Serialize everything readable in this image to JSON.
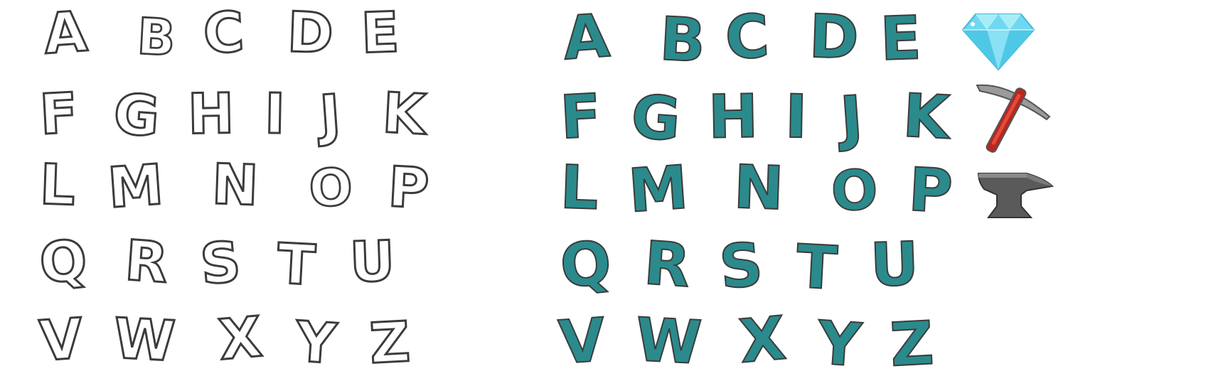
{
  "alphabet": {
    "rows": [
      [
        "A",
        "B",
        "C",
        "D",
        "E"
      ],
      [
        "F",
        "G",
        "H",
        "I",
        "J",
        "K"
      ],
      [
        "L",
        "M",
        "N",
        "O",
        "P"
      ],
      [
        "Q",
        "R",
        "S",
        "T",
        "U"
      ],
      [
        "V",
        "W",
        "X",
        "Y",
        "Z"
      ]
    ]
  },
  "colors": {
    "outline_fill": "#ffffff",
    "outline_stroke": "#3b3b3b",
    "filled_fill": "#2b8a8c",
    "diamond": "#6fd8f0",
    "pickaxe_handle": "#b8261f",
    "anvil": "#5a5a5a"
  },
  "icons": [
    "diamond-icon",
    "pickaxe-icon",
    "anvil-icon"
  ]
}
